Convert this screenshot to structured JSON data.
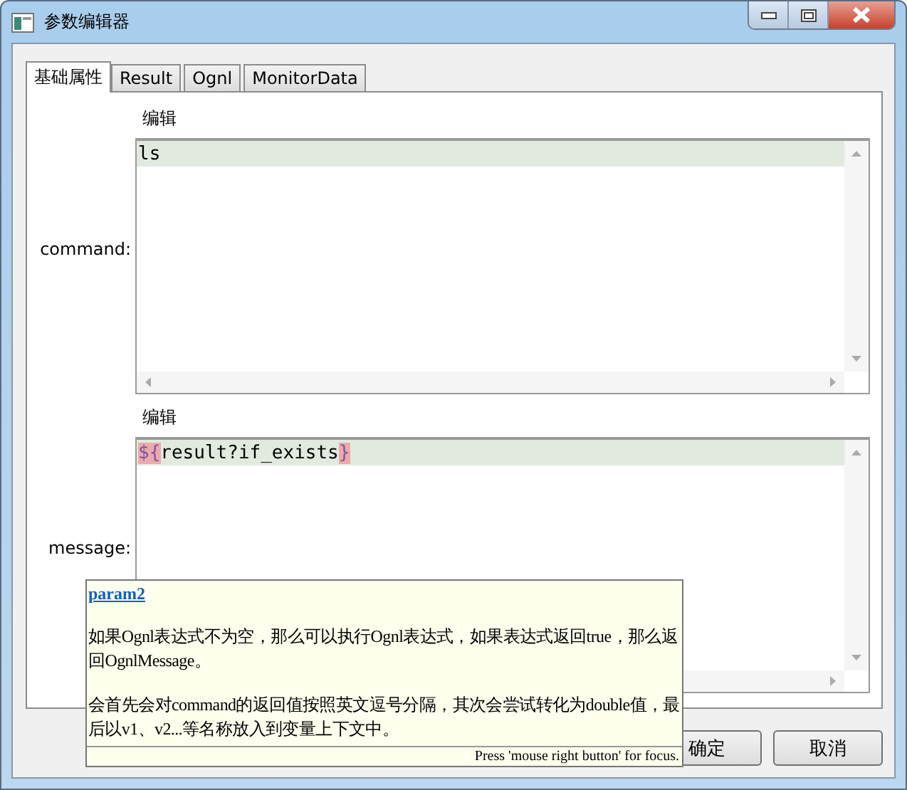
{
  "window": {
    "title": "参数编辑器"
  },
  "tabs": [
    {
      "label": "基础属性",
      "selected": true
    },
    {
      "label": "Result",
      "selected": false
    },
    {
      "label": "Ognl",
      "selected": false
    },
    {
      "label": "MonitorData",
      "selected": false
    }
  ],
  "fields": [
    {
      "label": "command:",
      "editor_label": "编辑",
      "segments": [
        {
          "text": "ls",
          "kind": "plain"
        }
      ]
    },
    {
      "label": "message:",
      "editor_label": "编辑",
      "segments": [
        {
          "text": "${",
          "kind": "bracket"
        },
        {
          "text": "result?if_exists",
          "kind": "plain"
        },
        {
          "text": "}",
          "kind": "bracket"
        }
      ]
    }
  ],
  "tooltip": {
    "title": "param2",
    "paragraphs": [
      "如果Ognl表达式不为空，那么可以执行Ognl表达式，如果表达式返回true，那么返回OgnlMessage。",
      "会首先会对command的返回值按照英文逗号分隔，其次会尝试转化为double值，最后以v1、v2...等名称放入到变量上下文中。"
    ],
    "footer": "Press 'mouse right button' for focus."
  },
  "buttons": [
    "确定",
    "取消"
  ]
}
